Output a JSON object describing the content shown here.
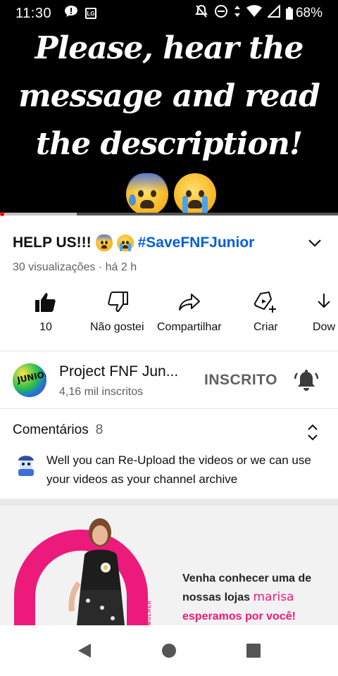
{
  "status_bar": {
    "time": "11:30",
    "battery": "68%",
    "icons": [
      "chat-alert-icon",
      "lg-icon",
      "mute-icon",
      "dnd-icon",
      "data-arrows-icon",
      "wifi-icon",
      "signal-icon",
      "battery-icon"
    ]
  },
  "video": {
    "caption": "Please, hear the message and read the description!",
    "progress_fraction": 0.227
  },
  "title": {
    "text": "HELP US!!!",
    "hashtag": "#SaveFNFJunior",
    "meta": "30 visualizações · há 2 h"
  },
  "actions": {
    "like_count": "10",
    "dislike_label": "Não gostei",
    "share_label": "Compartilhar",
    "create_label": "Criar",
    "download_label": "Dow"
  },
  "channel": {
    "name": "Project FNF Jun...",
    "subscribers": "4,16 mil inscritos",
    "subscribed_label": "INSCRITO",
    "avatar_text": "JUNIOR"
  },
  "comments": {
    "header": "Comentários",
    "count": "8",
    "top_comment": "Well you can Re-Upload the videos or we can use your videos as your channel archive"
  },
  "ad": {
    "line1": "Venha conhecer uma de",
    "line2_prefix": "nossas lojas",
    "brand": "marisa",
    "tagline": "esperamos por você!",
    "vertical_text": "MULHER PRA MULHER"
  },
  "colors": {
    "link_blue": "#065fd4",
    "ad_pink": "#ec1a7a",
    "progress_red": "#ff0000"
  }
}
